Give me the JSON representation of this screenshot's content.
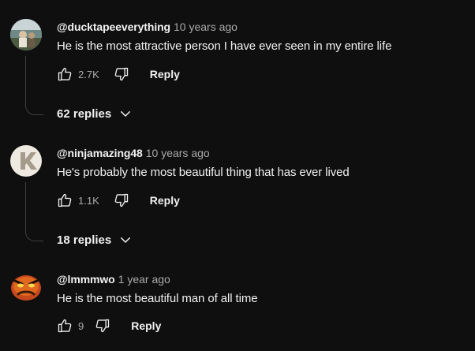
{
  "comments": [
    {
      "author": "@ducktapeeverything",
      "time": "10 years ago",
      "text": "He is the most attractive person I have ever seen in my entire life",
      "likes": "2.7K",
      "reply_label": "Reply",
      "replies_label": "62 replies"
    },
    {
      "author": "@ninjamazing48",
      "time": "10 years ago",
      "text": "He's probably the most beautiful thing that has ever lived",
      "likes": "1.1K",
      "reply_label": "Reply",
      "replies_label": "18 replies",
      "avatar_letter": "K"
    },
    {
      "author": "@lmmmwo",
      "time": "1 year ago",
      "text": "He is the most beautiful man of all time",
      "likes": "9",
      "reply_label": "Reply"
    }
  ],
  "icons": {
    "like": "thumb-up-icon",
    "dislike": "thumb-down-icon",
    "expand": "chevron-down-icon"
  },
  "colors": {
    "background": "#0f0f0f",
    "text_primary": "#f1f1f1",
    "text_secondary": "#aaaaaa"
  }
}
